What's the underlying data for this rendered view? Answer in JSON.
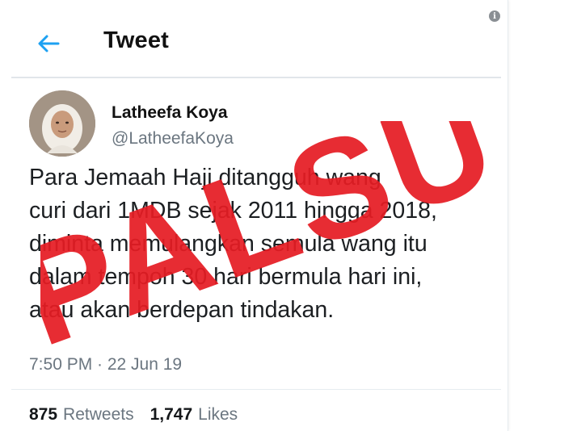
{
  "header": {
    "title": "Tweet",
    "back_icon": "arrow-left-icon",
    "accent": "#1da1f2"
  },
  "tweet": {
    "author_name": "Latheefa Koya",
    "author_handle": "@LatheefaKoya",
    "text_lines": [
      "Para Jemaah Haji ditangguh wang",
      "curi dari 1MDB sejak 2011 hingga 2018,",
      "diminta memulangkan semula wang itu",
      "dalam tempoh 30 hari bermula hari ini,",
      "atau akan berdepan tindakan."
    ],
    "timestamp": "7:50 PM · 22 Jun 19",
    "retweets_count": "875",
    "retweets_label": "Retweets",
    "likes_count": "1,747",
    "likes_label": "Likes"
  },
  "overlay": {
    "stamp_text": "PALSU",
    "stamp_color": "#e51c23"
  }
}
